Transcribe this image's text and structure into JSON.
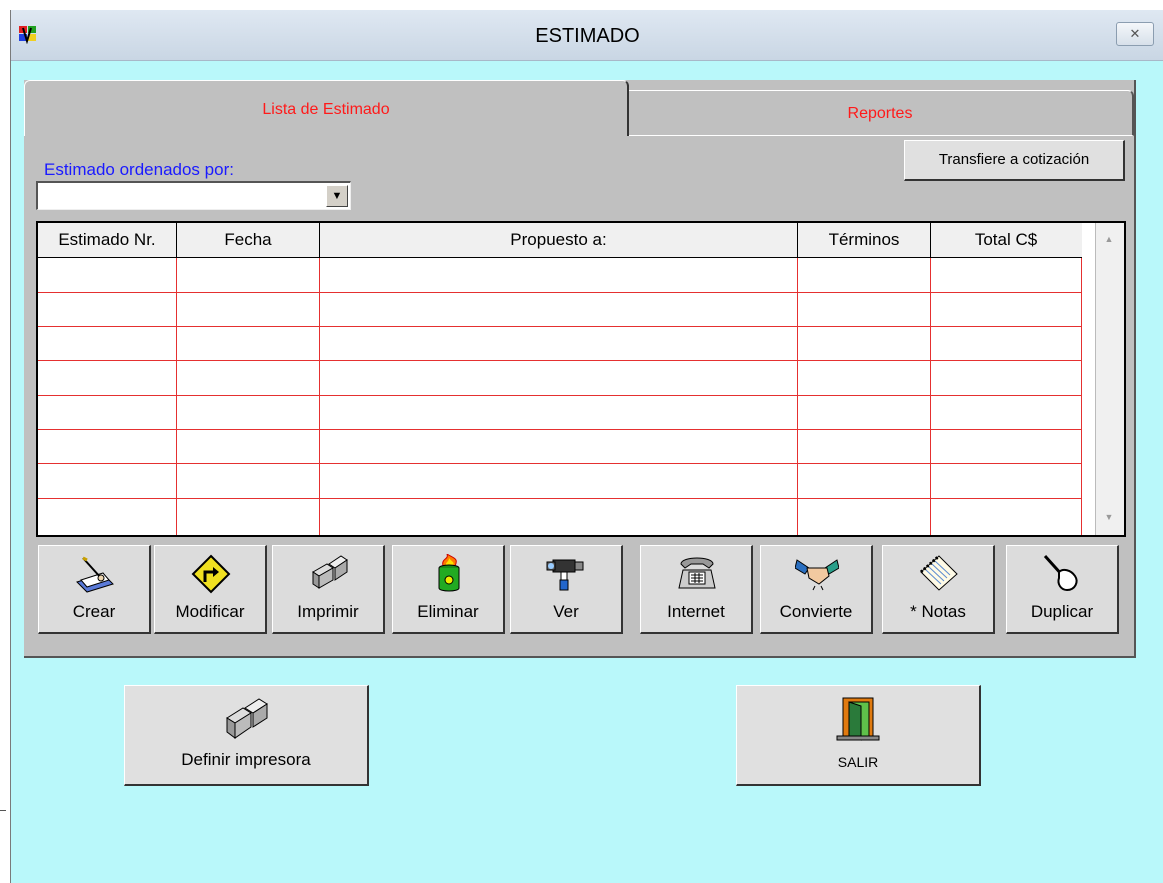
{
  "window": {
    "title": "ESTIMADO",
    "close_symbol": "✕"
  },
  "tabs": [
    {
      "label": "Lista de Estimado",
      "active": true
    },
    {
      "label": "Reportes",
      "active": false
    }
  ],
  "order": {
    "label": "Estimado ordenados por:",
    "value": "",
    "arrow": "▼"
  },
  "transfer_button": "Transfiere a cotización",
  "table": {
    "columns": [
      "Estimado Nr.",
      "Fecha",
      "Propuesto a:",
      "Términos",
      "Total  C$"
    ],
    "rows": [],
    "scroll_up": "▲",
    "scroll_down": "▼"
  },
  "toolbar": [
    {
      "label": "Crear",
      "icon": "pen-notepad-icon"
    },
    {
      "label": "Modificar",
      "icon": "turn-sign-icon"
    },
    {
      "label": "Imprimir",
      "icon": "printer-icon"
    },
    {
      "label": "Eliminar",
      "icon": "burning-barrel-icon"
    },
    {
      "label": "Ver",
      "icon": "camcorder-icon"
    },
    {
      "label": "Internet",
      "icon": "telephone-icon"
    },
    {
      "label": "Convierte",
      "icon": "handshake-icon"
    },
    {
      "label": "* Notas",
      "icon": "notebook-icon"
    },
    {
      "label": "Duplicar",
      "icon": "hand-pointer-icon"
    }
  ],
  "bottom": {
    "printer_button": "Definir impresora",
    "exit_button": "SALIR"
  },
  "colors": {
    "background": "#b9f8fa",
    "panel": "#c0c0c0",
    "tab_text": "#ff1a1a",
    "label_blue": "#1a1aff",
    "grid_lines": "#e53030"
  }
}
